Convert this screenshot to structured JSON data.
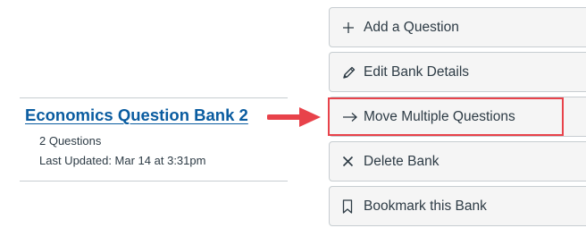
{
  "bank": {
    "title": "Economics Question Bank 2",
    "question_count": "2 Questions",
    "last_updated": "Last Updated: Mar 14 at 3:31pm"
  },
  "actions": [
    {
      "label": "Add a Question",
      "icon": "plus-icon"
    },
    {
      "label": "Edit Bank Details",
      "icon": "pencil-icon"
    },
    {
      "label": "Move Multiple Questions",
      "icon": "arrow-right-icon"
    },
    {
      "label": "Delete Bank",
      "icon": "x-icon"
    },
    {
      "label": "Bookmark this Bank",
      "icon": "bookmark-icon"
    }
  ],
  "colors": {
    "link": "#0a5ca0",
    "annotation": "#e8424a",
    "button_bg": "#f5f5f5",
    "text": "#2d3b45"
  }
}
